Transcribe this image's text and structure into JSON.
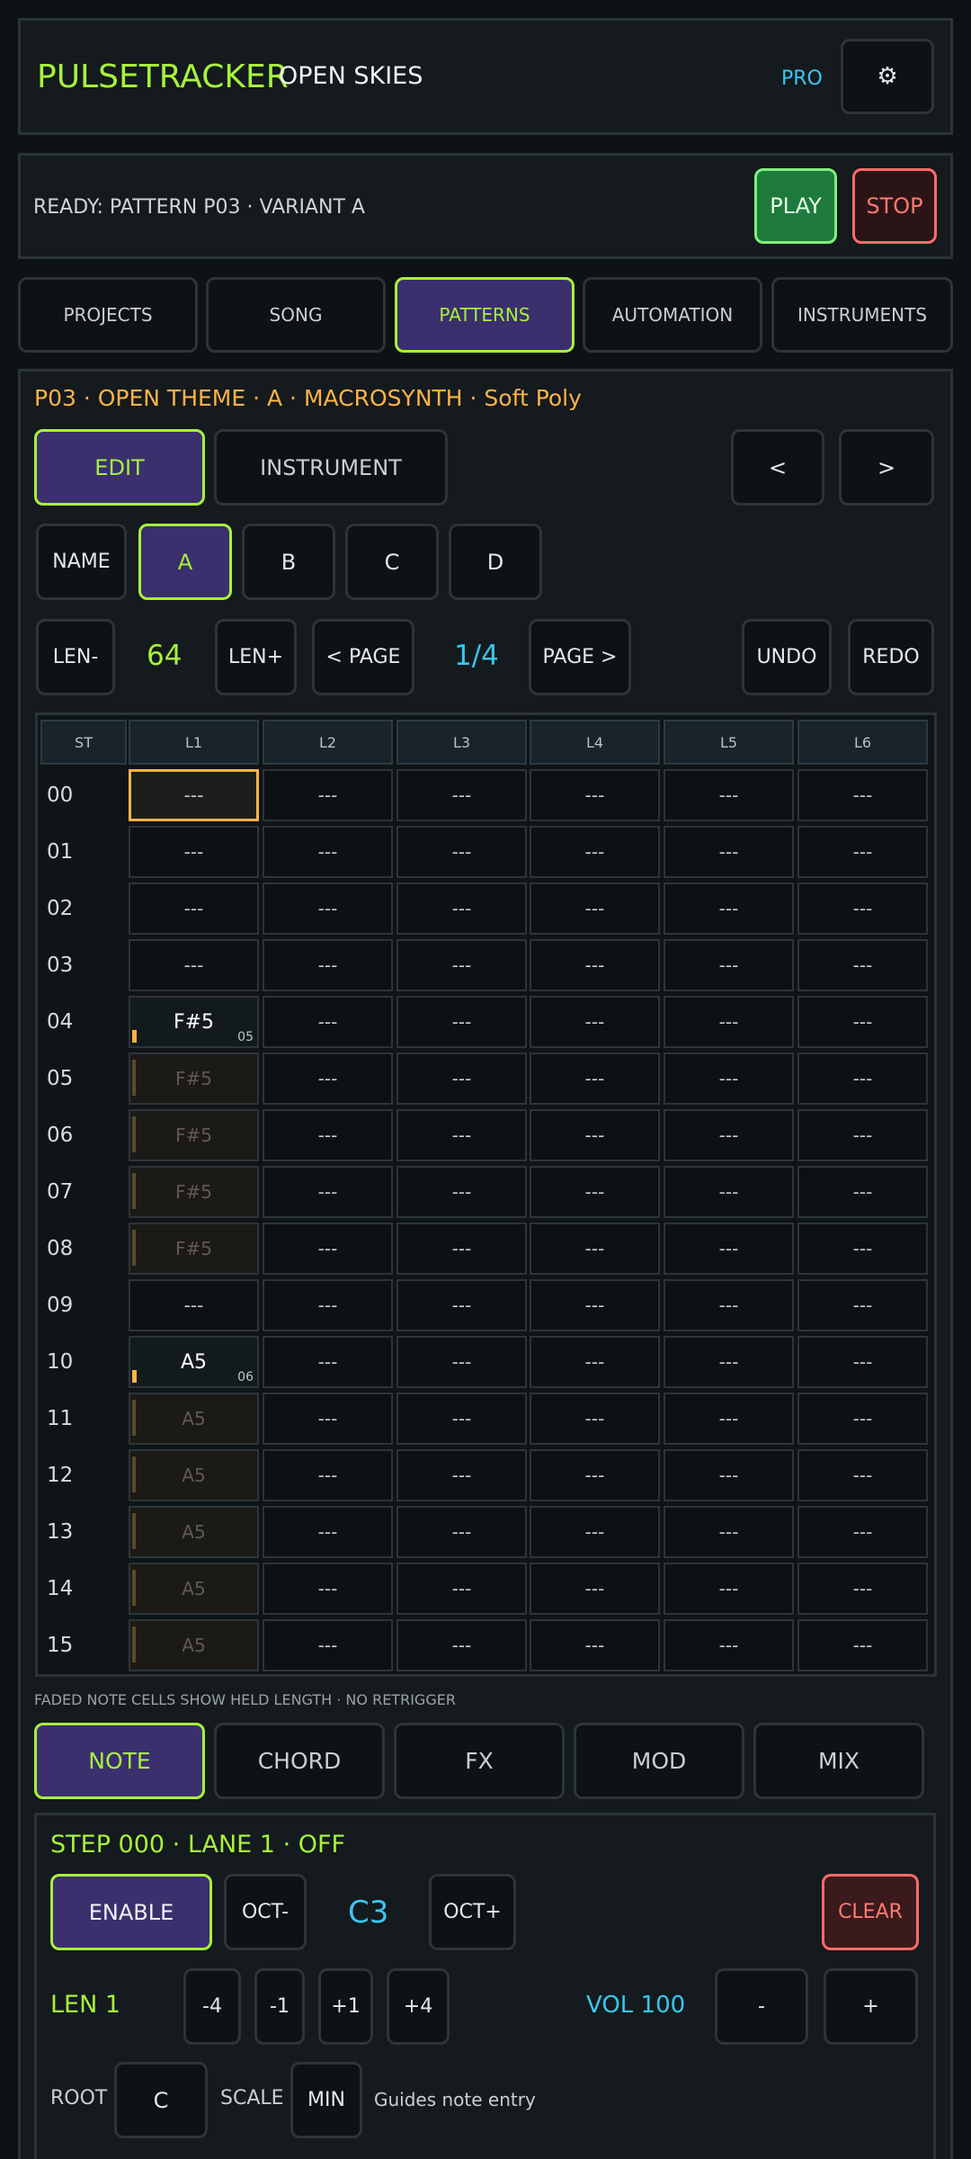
{
  "header": {
    "app_name": "PULSETRACKER",
    "project_name": "OPEN SKIES",
    "tier": "PRO",
    "settings_icon": "gear-icon"
  },
  "transport": {
    "status": "READY: PATTERN P03 · VARIANT A",
    "play_label": "PLAY",
    "stop_label": "STOP"
  },
  "tabs": [
    {
      "label": "PROJECTS",
      "active": false
    },
    {
      "label": "SONG",
      "active": false
    },
    {
      "label": "PATTERNS",
      "active": true
    },
    {
      "label": "AUTOMATION",
      "active": false
    },
    {
      "label": "INSTRUMENTS",
      "active": false
    }
  ],
  "pattern": {
    "title": "P03 · OPEN THEME · A · MACROSYNTH · Soft Poly",
    "edit_label": "EDIT",
    "instrument_label": "INSTRUMENT",
    "prev_label": "<",
    "next_label": ">",
    "name_label": "NAME",
    "variants": [
      "A",
      "B",
      "C",
      "D"
    ],
    "active_variant": "A",
    "len_minus": "LEN-",
    "length": "64",
    "len_plus": "LEN+",
    "page_prev": "< PAGE",
    "page": "1/4",
    "page_next": "PAGE >",
    "undo": "UNDO",
    "redo": "REDO"
  },
  "grid": {
    "step_header": "ST",
    "lanes": [
      "L1",
      "L2",
      "L3",
      "L4",
      "L5",
      "L6"
    ],
    "empty": "---",
    "rows": [
      {
        "step": "00",
        "l1": "---",
        "type": "sel"
      },
      {
        "step": "01",
        "l1": "---",
        "type": "empty"
      },
      {
        "step": "02",
        "l1": "---",
        "type": "empty"
      },
      {
        "step": "03",
        "l1": "---",
        "type": "empty"
      },
      {
        "step": "04",
        "l1": "F#5",
        "vel": "05",
        "type": "note"
      },
      {
        "step": "05",
        "l1": "F#5",
        "type": "held"
      },
      {
        "step": "06",
        "l1": "F#5",
        "type": "held"
      },
      {
        "step": "07",
        "l1": "F#5",
        "type": "held"
      },
      {
        "step": "08",
        "l1": "F#5",
        "type": "held"
      },
      {
        "step": "09",
        "l1": "---",
        "type": "empty"
      },
      {
        "step": "10",
        "l1": "A5",
        "vel": "06",
        "type": "note"
      },
      {
        "step": "11",
        "l1": "A5",
        "type": "held"
      },
      {
        "step": "12",
        "l1": "A5",
        "type": "held"
      },
      {
        "step": "13",
        "l1": "A5",
        "type": "held"
      },
      {
        "step": "14",
        "l1": "A5",
        "type": "held"
      },
      {
        "step": "15",
        "l1": "A5",
        "type": "held"
      }
    ],
    "footnote": "FADED NOTE CELLS SHOW HELD LENGTH · NO RETRIGGER"
  },
  "modes": [
    {
      "label": "NOTE",
      "active": true
    },
    {
      "label": "CHORD",
      "active": false
    },
    {
      "label": "FX",
      "active": false
    },
    {
      "label": "MOD",
      "active": false
    },
    {
      "label": "MIX",
      "active": false
    }
  ],
  "editor": {
    "step_info": "STEP 000 · LANE 1 · OFF",
    "enable": "ENABLE",
    "oct_minus": "OCT-",
    "note": "C3",
    "oct_plus": "OCT+",
    "clear": "CLEAR",
    "len_label": "LEN 1",
    "len_steps": [
      "-4",
      "-1",
      "+1",
      "+4"
    ],
    "vol_label": "VOL 100",
    "vol_minus": "-",
    "vol_plus": "+",
    "root_label": "ROOT",
    "root_value": "C",
    "scale_label": "SCALE",
    "scale_value": "MIN",
    "scale_hint": "Guides note entry"
  },
  "colors": {
    "accent": "#a7f23b",
    "info": "#38c7ef",
    "highlight": "#ffb347",
    "active_bg": "#3b2f6e",
    "danger": "#ff6a6a"
  }
}
